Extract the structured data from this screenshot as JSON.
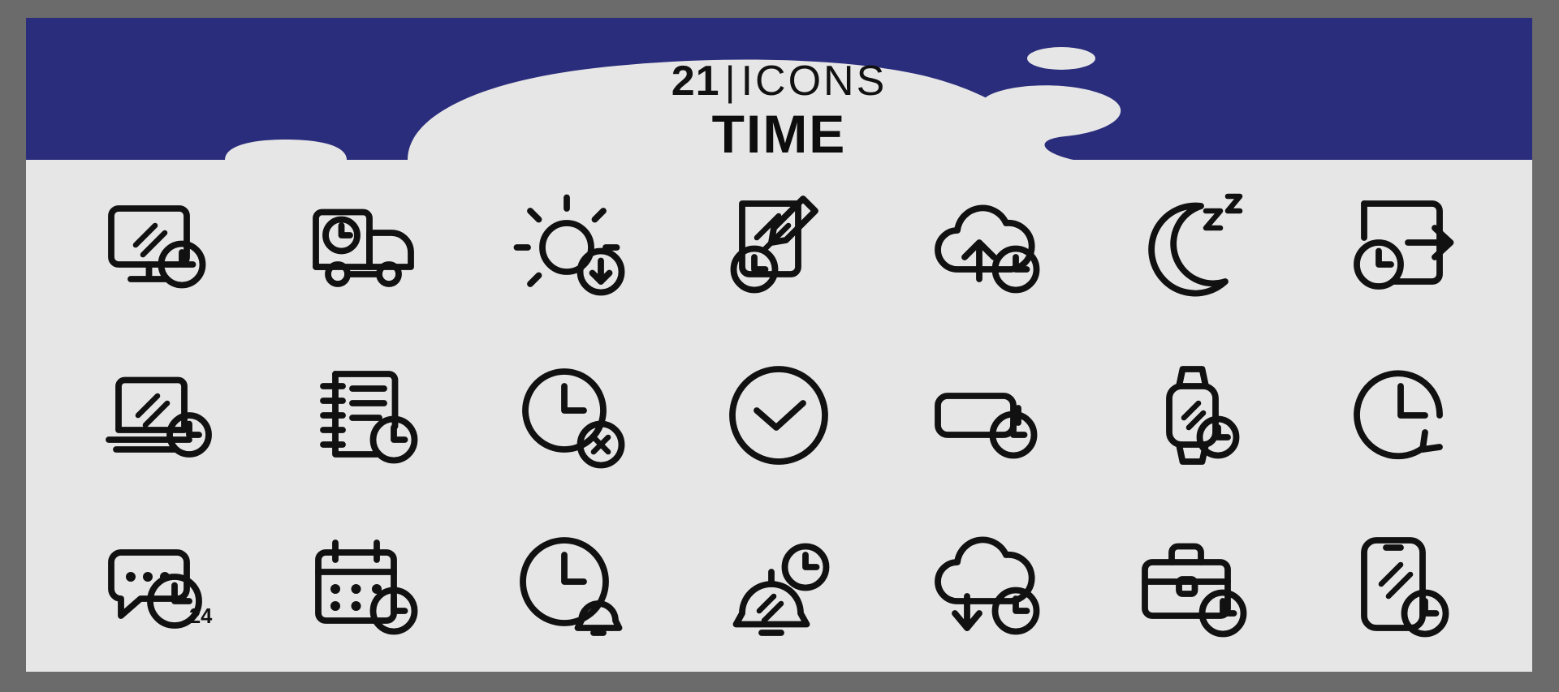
{
  "poster": {
    "background_color": "#e6e6e6",
    "frame_color": "#6b6b6b",
    "banner_color": "#2a2c7c",
    "stroke_color": "#111111"
  },
  "header": {
    "count": "21",
    "separator": "|",
    "word": "ICONS",
    "subtitle": "TIME"
  },
  "icons": [
    {
      "name": "monitor-clock-icon",
      "label": "Monitor with clock",
      "row": 1,
      "col": 1
    },
    {
      "name": "delivery-truck-clock-icon",
      "label": "Delivery truck with clock",
      "row": 1,
      "col": 2
    },
    {
      "name": "sunset-clock-icon",
      "label": "Sun with down arrow",
      "row": 1,
      "col": 3
    },
    {
      "name": "note-pencil-clock-icon",
      "label": "Note and pencil with clock",
      "row": 1,
      "col": 4
    },
    {
      "name": "cloud-upload-clock-icon",
      "label": "Cloud upload with clock",
      "row": 1,
      "col": 5
    },
    {
      "name": "moon-sleep-icon",
      "label": "Crescent moon with zzz",
      "row": 1,
      "col": 6,
      "sleep_text": "z"
    },
    {
      "name": "file-export-clock-icon",
      "label": "File with arrow and clock",
      "row": 1,
      "col": 7
    },
    {
      "name": "laptop-clock-icon",
      "label": "Laptop with clock",
      "row": 2,
      "col": 1
    },
    {
      "name": "notebook-clock-icon",
      "label": "Spiral notebook with clock",
      "row": 2,
      "col": 2
    },
    {
      "name": "clock-cancel-icon",
      "label": "Clock with cross",
      "row": 2,
      "col": 3
    },
    {
      "name": "clock-check-icon",
      "label": "Clock with check",
      "row": 2,
      "col": 4
    },
    {
      "name": "battery-clock-icon",
      "label": "Battery with clock",
      "row": 2,
      "col": 5
    },
    {
      "name": "smartwatch-clock-icon",
      "label": "Smartwatch with clock",
      "row": 2,
      "col": 6
    },
    {
      "name": "clock-refresh-icon",
      "label": "Clock with arrow",
      "row": 2,
      "col": 7
    },
    {
      "name": "chat-support-24-icon",
      "label": "Chat bubble with 24h clock",
      "row": 3,
      "col": 1,
      "badge": "24"
    },
    {
      "name": "calendar-clock-icon",
      "label": "Calendar with clock",
      "row": 3,
      "col": 2
    },
    {
      "name": "clock-alarm-bell-icon",
      "label": "Clock with bell",
      "row": 3,
      "col": 3
    },
    {
      "name": "bell-clock-icon",
      "label": "Bell with clock",
      "row": 3,
      "col": 4
    },
    {
      "name": "cloud-download-clock-icon",
      "label": "Cloud download with clock",
      "row": 3,
      "col": 5
    },
    {
      "name": "briefcase-clock-icon",
      "label": "Briefcase with clock",
      "row": 3,
      "col": 6
    },
    {
      "name": "smartphone-clock-icon",
      "label": "Smartphone with clock",
      "row": 3,
      "col": 7
    }
  ]
}
